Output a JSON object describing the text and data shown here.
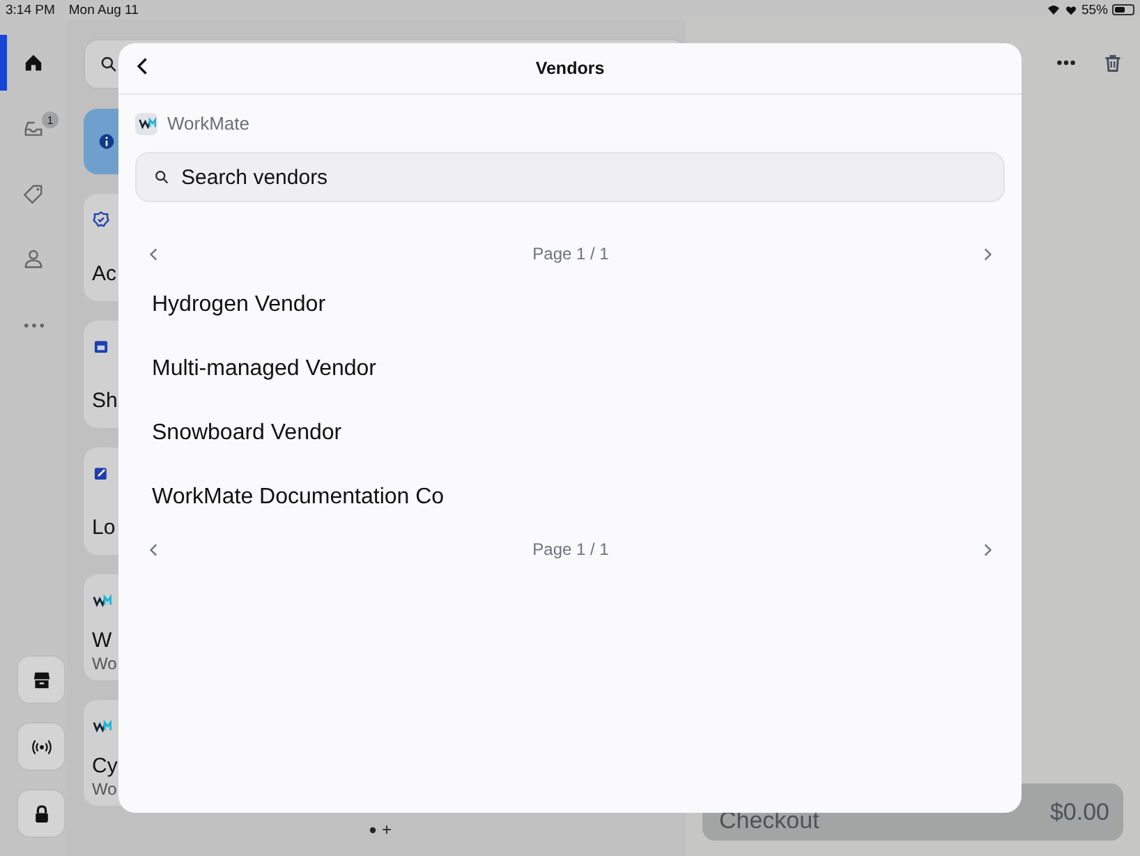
{
  "status_bar": {
    "time": "3:14 PM",
    "date": "Mon Aug 11",
    "battery": "55%"
  },
  "sidebar": {
    "items": [
      {
        "kind": "home",
        "selected": true
      },
      {
        "kind": "inbox",
        "selected": false,
        "badge": "1"
      },
      {
        "kind": "tag",
        "selected": false
      },
      {
        "kind": "person",
        "selected": false
      },
      {
        "kind": "more",
        "selected": false
      }
    ],
    "bottom_buttons": [
      {
        "kind": "store"
      },
      {
        "kind": "broadcast"
      },
      {
        "kind": "lock"
      }
    ]
  },
  "cards": [
    {
      "kind": "info"
    },
    {
      "kind": "badge-check",
      "title": "Ac"
    },
    {
      "kind": "calendar",
      "title": "Sh"
    },
    {
      "kind": "edit",
      "title": "Lo"
    },
    {
      "kind": "brand",
      "title": "W",
      "subtitle": "Wo"
    },
    {
      "kind": "brand",
      "title": "Cy",
      "subtitle": "Wo"
    }
  ],
  "page_indicator": {
    "add": "+"
  },
  "cart": {
    "checkout": {
      "label": "Checkout",
      "total": "$0.00"
    }
  },
  "modal": {
    "title": "Vendors",
    "brand": "WorkMate",
    "search": {
      "placeholder": "Search vendors"
    },
    "pager_top": "Page 1 / 1",
    "vendors": [
      "Hydrogen Vendor",
      "Multi-managed Vendor",
      "Snowboard Vendor",
      "WorkMate Documentation Co"
    ],
    "pager_bottom": "Page 1 / 1"
  }
}
